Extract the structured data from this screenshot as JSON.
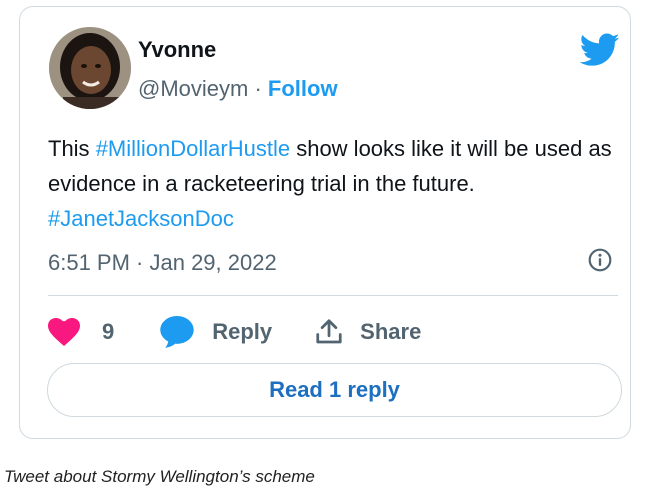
{
  "tweet": {
    "author_name": "Yvonne",
    "handle": "@Movieym",
    "separator": " · ",
    "follow_label": "Follow",
    "text": {
      "part1": "This ",
      "hashtag1": "#MillionDollarHustle",
      "part2": " show looks like it will be used as evidence in a racketeering trial in the future. ",
      "hashtag2": "#JanetJacksonDoc"
    },
    "timestamp": "6:51 PM · Jan 29, 2022",
    "like_count": "9",
    "reply_label": "Reply",
    "share_label": "Share",
    "read_replies_label": "Read 1 reply"
  },
  "caption": "Tweet about Stormy Wellington’s scheme",
  "icons": {
    "brand": "twitter-bird-icon",
    "like": "heart-icon",
    "reply": "speech-bubble-icon",
    "share": "share-upload-icon",
    "info": "info-icon"
  },
  "colors": {
    "twitter_blue": "#1d9bf0",
    "like_pink": "#f91880",
    "reply_blue": "#1d9bf0",
    "text_dark": "#0f1419",
    "text_gray": "#536471",
    "border": "#cfd9de"
  }
}
